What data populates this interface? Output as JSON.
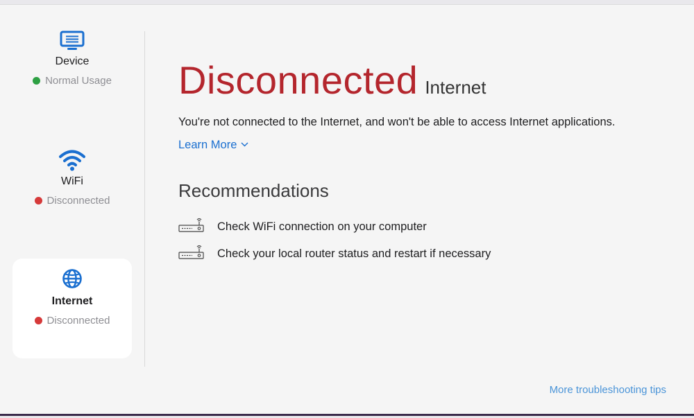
{
  "colors": {
    "accent": "#1a6fd0",
    "error": "#b4262d",
    "ok_dot": "#2ea043",
    "bad_dot": "#d63a3a"
  },
  "sidebar": {
    "items": [
      {
        "icon": "monitor-icon",
        "label": "Device",
        "status": "Normal Usage",
        "status_color": "#2ea043",
        "selected": false
      },
      {
        "icon": "wifi-icon",
        "label": "WiFi",
        "status": "Disconnected",
        "status_color": "#d63a3a",
        "selected": false
      },
      {
        "icon": "globe-icon",
        "label": "Internet",
        "status": "Disconnected",
        "status_color": "#d63a3a",
        "selected": true
      }
    ]
  },
  "main": {
    "status": "Disconnected",
    "subject": "Internet",
    "description": "You're not connected to the Internet, and won't be able to access Internet applications.",
    "learn_more": "Learn More",
    "recommendations_title": "Recommendations",
    "recommendations": [
      {
        "icon": "router-icon",
        "text": "Check WiFi connection on your computer"
      },
      {
        "icon": "router-icon",
        "text": "Check your local router status and restart if necessary"
      }
    ],
    "more_tips": "More troubleshooting tips"
  }
}
